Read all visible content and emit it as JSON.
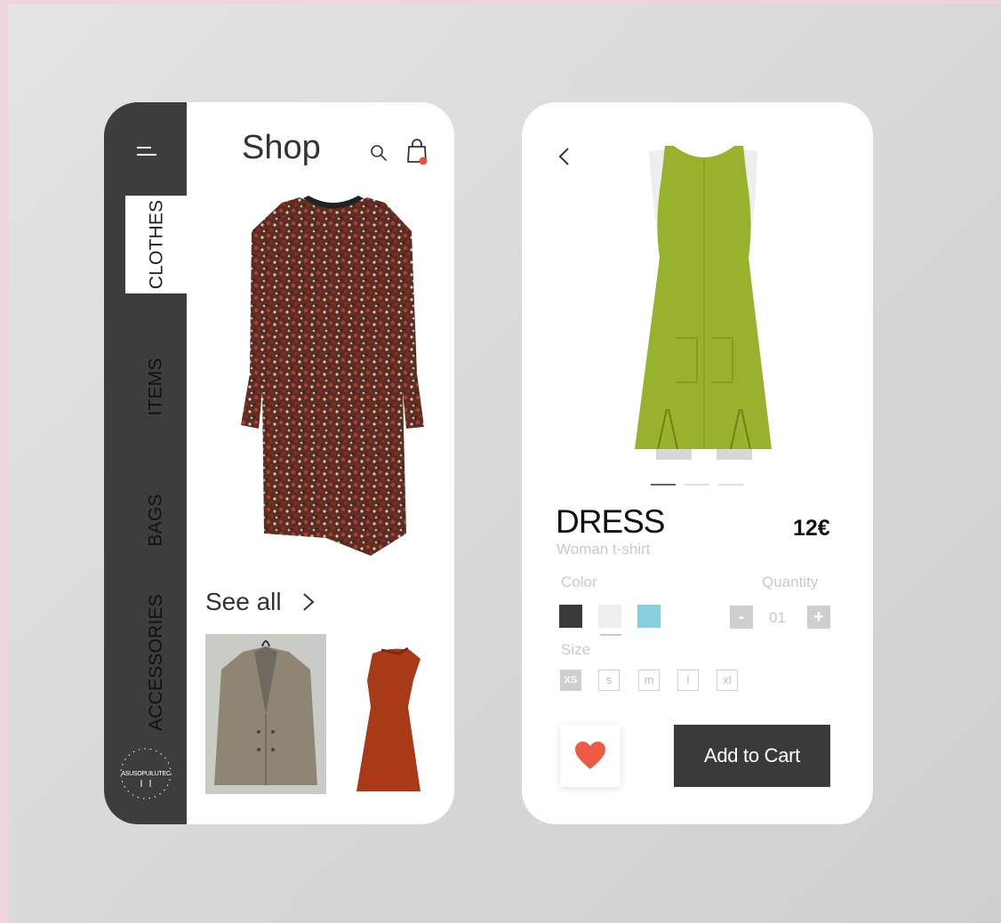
{
  "shop": {
    "title": "Shop",
    "categories": [
      {
        "label": "CLOTHES",
        "active": true
      },
      {
        "label": "ITEMS",
        "active": false
      },
      {
        "label": "BAGS",
        "active": false
      },
      {
        "label": "ACCESSORIES",
        "active": false
      }
    ],
    "logo_text": "ASUSOPUILUTEC",
    "see_all_label": "See all",
    "icons": {
      "menu": "hamburger-menu-icon",
      "search": "search-icon",
      "cart": "shopping-bag-icon",
      "see_all": "chevron-right-icon"
    },
    "cart_badge_color": "#e8523a"
  },
  "product": {
    "name": "DRESS",
    "subtitle": "Woman t-shirt",
    "price": "12€",
    "carousel_active_index": 0,
    "carousel_count": 3,
    "color_label": "Color",
    "colors": [
      "#3a3a3a",
      "#efefef",
      "#87cfe0"
    ],
    "selected_color_index": 1,
    "quantity_label": "Quantity",
    "quantity_value": "01",
    "quantity_minus": "-",
    "quantity_plus": "+",
    "size_label": "Size",
    "sizes": [
      "XS",
      "s",
      "m",
      "l",
      "xl"
    ],
    "selected_size": "XS",
    "add_to_cart_label": "Add to Cart",
    "favorite_color": "#ef5a45",
    "icons": {
      "back": "chevron-left-icon",
      "favorite": "heart-icon"
    }
  }
}
